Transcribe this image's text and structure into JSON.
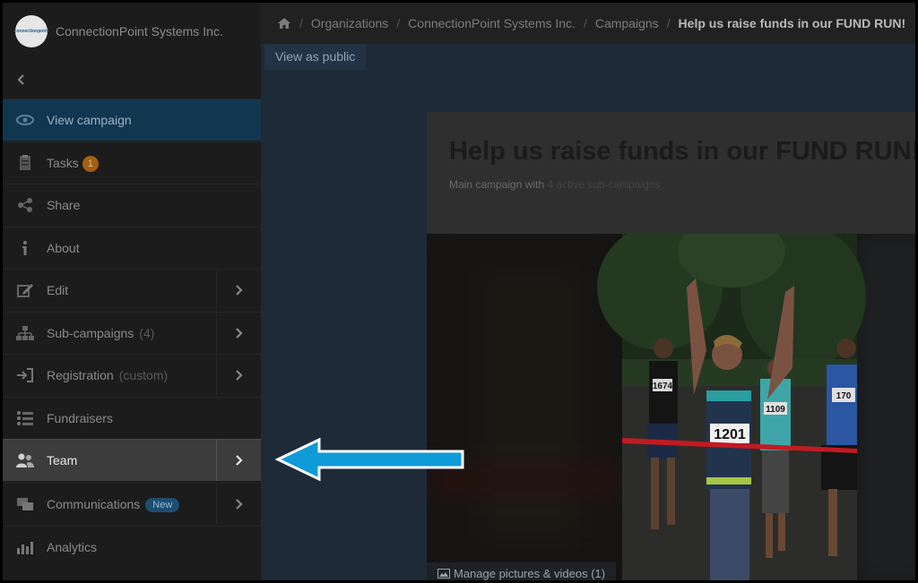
{
  "org": {
    "name": "ConnectionPoint Systems Inc.",
    "logo_text": "connectionpoint"
  },
  "breadcrumb": {
    "items": [
      "Organizations",
      "ConnectionPoint Systems Inc.",
      "Campaigns"
    ],
    "current": "Help us raise funds in our FUND RUN!"
  },
  "sidebar": {
    "items": [
      {
        "label": "View campaign",
        "icon": "eye-icon"
      },
      {
        "label": "Tasks",
        "badge": "1",
        "icon": "clipboard-icon"
      },
      {
        "label": "Share",
        "icon": "share-icon"
      },
      {
        "label": "About",
        "icon": "info-icon"
      },
      {
        "label": "Edit",
        "icon": "edit-icon"
      },
      {
        "label": "Sub-campaigns",
        "sub": "(4)",
        "icon": "hierarchy-icon"
      },
      {
        "label": "Registration",
        "sub": "(custom)",
        "icon": "sign-in-icon"
      },
      {
        "label": "Fundraisers",
        "icon": "list-icon"
      },
      {
        "label": "Team",
        "icon": "users-icon"
      },
      {
        "label": "Communications",
        "badge": "New",
        "icon": "chat-icon"
      },
      {
        "label": "Analytics",
        "icon": "bar-chart-icon"
      }
    ]
  },
  "view_public_label": "View as public",
  "campaign": {
    "title": "Help us raise funds in our FUND RUN!",
    "sub_prefix": "Main campaign with",
    "sub_strong": "4 active sub-campaigns"
  },
  "hero": {
    "bibs": [
      "1201",
      "1674",
      "1109",
      "170"
    ]
  },
  "manage_label": "Manage pictures & videos (1)",
  "colors": {
    "accent": "#0f9ad8",
    "highlight": "#3c3c3c",
    "active": "#113650"
  }
}
